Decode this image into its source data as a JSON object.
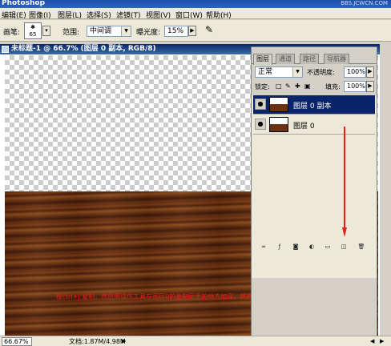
{
  "app": {
    "title": "Photoshop",
    "watermark": "BBS.JCWCN.COM"
  },
  "menu": {
    "items": [
      "编辑(E)",
      "图像(I)",
      "图层(L)",
      "选择(S)",
      "滤镜(T)",
      "视图(V)",
      "窗口(W)",
      "帮助(H)"
    ]
  },
  "options": {
    "brush_label": "画笔:",
    "brush_size": "65",
    "range_label": "范围:",
    "range_value": "中间调",
    "exposure_label": "曝光度:",
    "exposure_value": "15%"
  },
  "document": {
    "title": "未标题-1 @ 66.7% (图层 0 副本, RGB/8)"
  },
  "status": {
    "zoom": "66.67%",
    "doc_info": "文档:1.87M/4.98M"
  },
  "layers_panel": {
    "tabs": [
      "图层",
      "通道",
      "路径",
      "导航器"
    ],
    "blend_mode": "正常",
    "opacity_label": "不透明度:",
    "opacity_value": "100%",
    "lock_label": "锁定:",
    "fill_label": "填充:",
    "fill_value": "100%",
    "layers": [
      {
        "name": "图层 0 副本",
        "selected": true
      },
      {
        "name": "图层 0",
        "selected": false
      }
    ]
  },
  "annotation": {
    "text": "按ctrl+j 复制，然后用烧伤工具在图层0的复制层里的地方加深，然后点击，再复制出图层0副本"
  },
  "colors": {
    "annotation": "#e82018",
    "selection": "#0a246a"
  }
}
